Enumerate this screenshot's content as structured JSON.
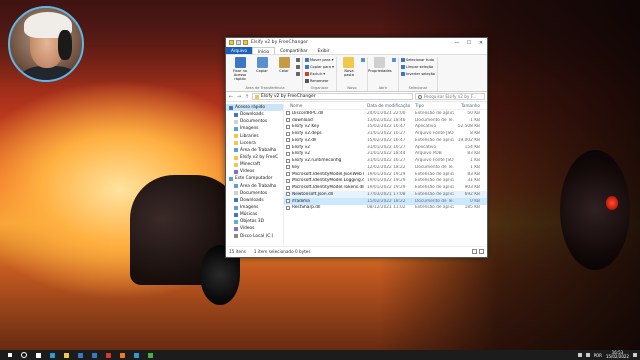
{
  "window": {
    "title": "Elsify v2 by FreeChanger",
    "controls": {
      "minimize": "—",
      "maximize": "☐",
      "close": "✕"
    }
  },
  "ribbon": {
    "tabs": [
      "Arquivo",
      "Início",
      "Compartilhar",
      "Exibir"
    ],
    "groups": [
      {
        "label": "Área de Transferência",
        "big": [
          {
            "label": "Fixar no Acesso rápido",
            "icon": "pin-icon",
            "color": "#3b78c4"
          },
          {
            "label": "Copiar",
            "icon": "copy-icon",
            "color": "#5a8fd0"
          },
          {
            "label": "Colar",
            "icon": "paste-icon",
            "color": "#c79a45"
          }
        ],
        "small": [
          {
            "label": "",
            "icon": "cut-icon",
            "color": "#666"
          },
          {
            "label": "",
            "icon": "copy-path-icon",
            "color": "#666"
          },
          {
            "label": "",
            "icon": "paste-shortcut-icon",
            "color": "#666"
          }
        ]
      },
      {
        "label": "Organizar",
        "big": [],
        "small": [
          {
            "label": "Mover para ▾",
            "icon": "move-to-icon",
            "color": "#3b78c4"
          },
          {
            "label": "Copiar para ▾",
            "icon": "copy-to-icon",
            "color": "#3b78c4"
          },
          {
            "label": "Excluir ▾",
            "icon": "delete-icon",
            "color": "#d83b2b"
          },
          {
            "label": "Renomear",
            "icon": "rename-icon",
            "color": "#555"
          }
        ]
      },
      {
        "label": "Novo",
        "big": [
          {
            "label": "Nova pasta",
            "icon": "new-folder-icon",
            "color": "#f2c84b"
          }
        ],
        "small": [
          {
            "label": "",
            "icon": "new-item-icon",
            "color": "#5a8fd0"
          }
        ]
      },
      {
        "label": "Abrir",
        "big": [
          {
            "label": "Propriedades",
            "icon": "properties-icon",
            "color": "#d0d0d0"
          }
        ],
        "small": [
          {
            "label": "",
            "icon": "open-icon",
            "color": "#5a8fd0"
          }
        ]
      },
      {
        "label": "Selecionar",
        "big": [],
        "small": [
          {
            "label": "Selecionar tudo",
            "icon": "select-all-icon",
            "color": "#3b78c4"
          },
          {
            "label": "Limpar seleção",
            "icon": "select-none-icon",
            "color": "#3b78c4"
          },
          {
            "label": "Inverter seleção",
            "icon": "invert-selection-icon",
            "color": "#3b78c4"
          }
        ]
      }
    ]
  },
  "addressbar": {
    "back": "←",
    "forward": "→",
    "up": "↑",
    "path": "Elsify v2 by FreeChanger",
    "search_placeholder": "Pesquisar Elsify v2 by F..."
  },
  "navpane": [
    {
      "label": "Acesso rápido",
      "head": true,
      "sub": false,
      "color": "#3b78c4"
    },
    {
      "label": "Downloads",
      "head": false,
      "sub": true,
      "color": "#3b78c4"
    },
    {
      "label": "Documentos",
      "head": false,
      "sub": true,
      "color": "#d0d0d0"
    },
    {
      "label": "Imagens",
      "head": false,
      "sub": true,
      "color": "#5a9fd8"
    },
    {
      "label": "Libraries",
      "head": false,
      "sub": true,
      "color": "#f2c84b"
    },
    {
      "label": "Licenra",
      "head": false,
      "sub": true,
      "color": "#f2c84b"
    },
    {
      "label": "Área de Trabalho",
      "head": false,
      "sub": true,
      "color": "#5a9fd8"
    },
    {
      "label": "Elsify v2 by FreeC",
      "head": false,
      "sub": true,
      "color": "#f2c84b"
    },
    {
      "label": "Minecraft",
      "head": false,
      "sub": true,
      "color": "#f2c84b"
    },
    {
      "label": "Vídeos",
      "head": false,
      "sub": true,
      "color": "#8a6ad0"
    },
    {
      "label": "Este Computador",
      "head": false,
      "sub": false,
      "color": "#5a9fd8"
    },
    {
      "label": "Área de Trabalho",
      "head": false,
      "sub": true,
      "color": "#5a9fd8"
    },
    {
      "label": "Documentos",
      "head": false,
      "sub": true,
      "color": "#d0d0d0"
    },
    {
      "label": "Downloads",
      "head": false,
      "sub": true,
      "color": "#3b78c4"
    },
    {
      "label": "Imagens",
      "head": false,
      "sub": true,
      "color": "#5a9fd8"
    },
    {
      "label": "Músicas",
      "head": false,
      "sub": true,
      "color": "#3b78c4"
    },
    {
      "label": "Objetos 3D",
      "head": false,
      "sub": true,
      "color": "#5ab0d8"
    },
    {
      "label": "Vídeos",
      "head": false,
      "sub": true,
      "color": "#8a6ad0"
    },
    {
      "label": "Disco Local (C:)",
      "head": false,
      "sub": true,
      "color": "#888"
    }
  ],
  "filelist": {
    "columns": {
      "name": "Nome",
      "date": "Data de modificação",
      "type": "Tipo",
      "size": "Tamanho"
    },
    "rows": [
      {
        "name": "DiscordRPC.dll",
        "date": "24/01/2021 22:00",
        "type": "Extensão de aplica...",
        "size": "50 KB",
        "state": ""
      },
      {
        "name": "download",
        "date": "13/02/2022 18:46",
        "type": "Documento de Te...",
        "size": "1 KB",
        "state": ""
      },
      {
        "name": "Elsify v2 Key",
        "date": "15/02/2022 16:47",
        "type": "Aplicativo",
        "size": "52.508 KB",
        "state": ""
      },
      {
        "name": "Elsify v2.deps",
        "date": "31/01/2022 16:27",
        "type": "Arquivo Fonte JSON",
        "size": "8 KB",
        "state": ""
      },
      {
        "name": "Elsify v2.dll",
        "date": "15/02/2022 16:47",
        "type": "Extensão de aplica...",
        "size": "19.002 KB",
        "state": ""
      },
      {
        "name": "Elsify v2",
        "date": "31/01/2022 16:27",
        "type": "Aplicativo",
        "size": "154 KB",
        "state": ""
      },
      {
        "name": "Elsify v2",
        "date": "31/01/2022 18:44",
        "type": "Arquivo PDB",
        "size": "83 KB",
        "state": ""
      },
      {
        "name": "Elsify v2.runtimeconfig",
        "date": "31/01/2022 16:27",
        "type": "Arquivo Fonte JSON",
        "size": "1 KB",
        "state": ""
      },
      {
        "name": "key",
        "date": "12/02/2022 18:22",
        "type": "Documento de Te...",
        "size": "1 KB",
        "state": ""
      },
      {
        "name": "Microsoft.IdentityModel.JsonWebTokens...",
        "date": "19/01/2022 19:29",
        "type": "Extensão de aplica...",
        "size": "83 KB",
        "state": ""
      },
      {
        "name": "Microsoft.IdentityModel.Logging.dll",
        "date": "19/01/2022 19:29",
        "type": "Extensão de aplica...",
        "size": "31 KB",
        "state": ""
      },
      {
        "name": "Microsoft.IdentityModel.Tokens.dll",
        "date": "19/01/2022 19:29",
        "type": "Extensão de aplica...",
        "size": "903 KB",
        "state": ""
      },
      {
        "name": "Newtonsoft.Json.dll",
        "date": "17/03/2021 17:08",
        "type": "Extensão de aplica...",
        "size": "692 KB",
        "state": "hover"
      },
      {
        "name": "ifradima",
        "date": "15/02/2022 18:22",
        "type": "Documento de Te...",
        "size": "0 KB",
        "state": "sel"
      },
      {
        "name": "RestSharp.dll",
        "date": "08/12/2021 11:02",
        "type": "Extensão de aplica...",
        "size": "185 KB",
        "state": ""
      }
    ]
  },
  "statusbar": {
    "count": "15 itens",
    "selection": "1 item selecionado 0 bytes"
  },
  "taskbar": {
    "apps": [
      {
        "name": "taskview-icon",
        "color": "#ffffff"
      },
      {
        "name": "edge-icon",
        "color": "#2e9ad6"
      },
      {
        "name": "explorer-icon",
        "color": "#f2c84b"
      },
      {
        "name": "store-icon",
        "color": "#3b78c4"
      },
      {
        "name": "mail-icon",
        "color": "#3b78c4"
      },
      {
        "name": "app-red-icon",
        "color": "#d83b2b"
      },
      {
        "name": "app-orange-icon",
        "color": "#f07a2a"
      },
      {
        "name": "app-blue-icon",
        "color": "#2e9ad6"
      },
      {
        "name": "app-green-icon",
        "color": "#46b04a"
      }
    ],
    "tray": {
      "lang": "POR",
      "time": "16:53",
      "date": "15/02/2022"
    }
  }
}
